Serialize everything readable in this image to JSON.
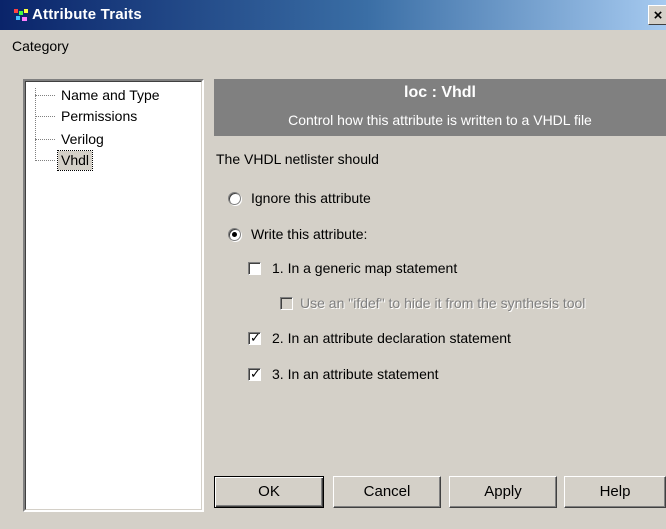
{
  "window": {
    "title": "Attribute Traits",
    "close_glyph": "×"
  },
  "category": {
    "label": "Category",
    "items": [
      {
        "label": "Name and Type",
        "selected": false
      },
      {
        "label": "Permissions",
        "selected": false
      },
      {
        "label": "Verilog",
        "selected": false
      },
      {
        "label": "Vhdl",
        "selected": true
      }
    ]
  },
  "header": {
    "title": "loc : Vhdl",
    "subtitle": "Control how this attribute is written to a VHDL file"
  },
  "main": {
    "intro": "The VHDL netlister should",
    "options": {
      "ignore": {
        "label": "Ignore this attribute",
        "selected": false
      },
      "write": {
        "label": "Write this attribute:",
        "selected": true
      }
    },
    "checks": {
      "generic_map": {
        "label": "1.  In a generic map statement",
        "checked": false,
        "enabled": true
      },
      "ifdef": {
        "label": "Use an \"ifdef\" to hide it from the synthesis tool",
        "checked": false,
        "enabled": false
      },
      "attr_decl": {
        "label": "2. In an attribute declaration statement",
        "checked": true,
        "enabled": true
      },
      "attr_stmt": {
        "label": "3. In an attribute statement",
        "checked": true,
        "enabled": true
      }
    }
  },
  "buttons": {
    "ok": "OK",
    "cancel": "Cancel",
    "apply": "Apply",
    "help": "Help"
  },
  "colors": {
    "title_gradient_start": "#0a246a",
    "title_gradient_end": "#a6caf0",
    "dialog_face": "#d4d0c8",
    "header_panel": "#808080"
  },
  "icons": {
    "app": "attribute-traits-app-icon",
    "close": "close-icon",
    "check": "check-mark-icon"
  }
}
